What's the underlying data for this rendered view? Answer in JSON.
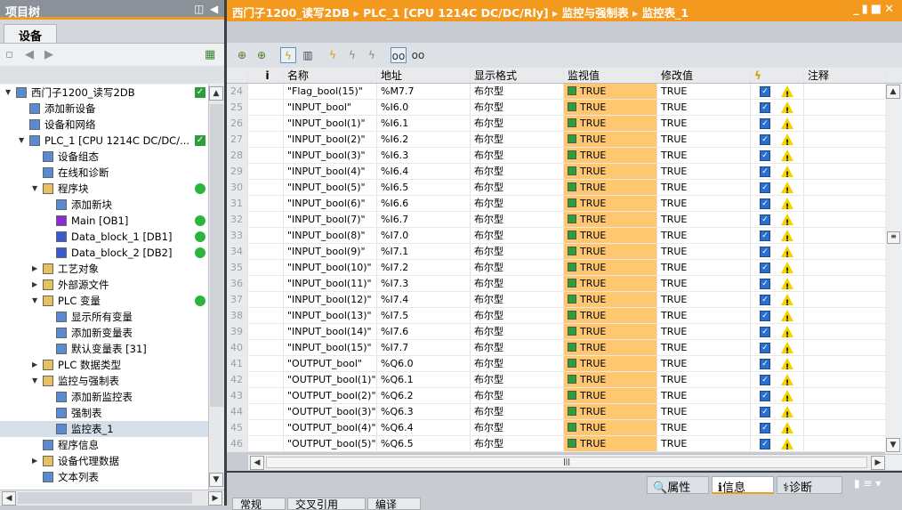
{
  "project_tree": {
    "title": "项目树",
    "tab": "设备",
    "items": [
      {
        "label": "西门子1200_读写2DB",
        "indent": 0,
        "expanded": true,
        "icon": "project-icon",
        "status": "check"
      },
      {
        "label": "添加新设备",
        "indent": 1,
        "icon": "add-device-icon"
      },
      {
        "label": "设备和网络",
        "indent": 1,
        "icon": "network-icon"
      },
      {
        "label": "PLC_1 [CPU 1214C DC/DC/...",
        "indent": 1,
        "expanded": true,
        "icon": "plc-icon",
        "status": "check"
      },
      {
        "label": "设备组态",
        "indent": 2,
        "icon": "device-config-icon"
      },
      {
        "label": "在线和诊断",
        "indent": 2,
        "icon": "diagnostics-icon"
      },
      {
        "label": "程序块",
        "indent": 2,
        "expanded": true,
        "icon": "folder-icon",
        "status": "ok"
      },
      {
        "label": "添加新块",
        "indent": 3,
        "icon": "add-block-icon"
      },
      {
        "label": "Main [OB1]",
        "indent": 3,
        "icon": "ob-icon",
        "status": "ok"
      },
      {
        "label": "Data_block_1 [DB1]",
        "indent": 3,
        "icon": "db-icon",
        "status": "ok"
      },
      {
        "label": "Data_block_2 [DB2]",
        "indent": 3,
        "icon": "db-icon",
        "status": "ok"
      },
      {
        "label": "工艺对象",
        "indent": 2,
        "expanded": false,
        "icon": "folder-icon"
      },
      {
        "label": "外部源文件",
        "indent": 2,
        "expanded": false,
        "icon": "folder-icon"
      },
      {
        "label": "PLC 变量",
        "indent": 2,
        "expanded": true,
        "icon": "folder-icon",
        "status": "ok"
      },
      {
        "label": "显示所有变量",
        "indent": 3,
        "icon": "tags-icon"
      },
      {
        "label": "添加新变量表",
        "indent": 3,
        "icon": "add-tag-table-icon"
      },
      {
        "label": "默认变量表 [31]",
        "indent": 3,
        "icon": "tag-table-icon"
      },
      {
        "label": "PLC 数据类型",
        "indent": 2,
        "expanded": false,
        "icon": "folder-icon"
      },
      {
        "label": "监控与强制表",
        "indent": 2,
        "expanded": true,
        "icon": "folder-icon"
      },
      {
        "label": "添加新监控表",
        "indent": 3,
        "icon": "add-watch-table-icon"
      },
      {
        "label": "强制表",
        "indent": 3,
        "icon": "force-table-icon"
      },
      {
        "label": "监控表_1",
        "indent": 3,
        "icon": "watch-table-icon",
        "selected": true
      },
      {
        "label": "程序信息",
        "indent": 2,
        "icon": "program-info-icon"
      },
      {
        "label": "设备代理数据",
        "indent": 2,
        "expanded": false,
        "icon": "folder-icon"
      },
      {
        "label": "文本列表",
        "indent": 2,
        "icon": "text-list-icon"
      }
    ]
  },
  "editor": {
    "breadcrumb": [
      "西门子1200_读写2DB",
      "PLC_1 [CPU 1214C DC/DC/Rly]",
      "监控与强制表",
      "监控表_1"
    ],
    "columns": [
      "",
      "i",
      "名称",
      "地址",
      "显示格式",
      "监视值",
      "修改值",
      "",
      "注释"
    ],
    "rows": [
      [
        "24",
        "\"Flag_bool(15)\"",
        "%M7.7"
      ],
      [
        "25",
        "\"INPUT_bool\"",
        "%I6.0"
      ],
      [
        "26",
        "\"INPUT_bool(1)\"",
        "%I6.1"
      ],
      [
        "27",
        "\"INPUT_bool(2)\"",
        "%I6.2"
      ],
      [
        "28",
        "\"INPUT_bool(3)\"",
        "%I6.3"
      ],
      [
        "29",
        "\"INPUT_bool(4)\"",
        "%I6.4"
      ],
      [
        "30",
        "\"INPUT_bool(5)\"",
        "%I6.5"
      ],
      [
        "31",
        "\"INPUT_bool(6)\"",
        "%I6.6"
      ],
      [
        "32",
        "\"INPUT_bool(7)\"",
        "%I6.7"
      ],
      [
        "33",
        "\"INPUT_bool(8)\"",
        "%I7.0"
      ],
      [
        "34",
        "\"INPUT_bool(9)\"",
        "%I7.1"
      ],
      [
        "35",
        "\"INPUT_bool(10)\"",
        "%I7.2"
      ],
      [
        "36",
        "\"INPUT_bool(11)\"",
        "%I7.3"
      ],
      [
        "37",
        "\"INPUT_bool(12)\"",
        "%I7.4"
      ],
      [
        "38",
        "\"INPUT_bool(13)\"",
        "%I7.5"
      ],
      [
        "39",
        "\"INPUT_bool(14)\"",
        "%I7.6"
      ],
      [
        "40",
        "\"INPUT_bool(15)\"",
        "%I7.7"
      ],
      [
        "41",
        "\"OUTPUT_bool\"",
        "%Q6.0"
      ],
      [
        "42",
        "\"OUTPUT_bool(1)\"",
        "%Q6.1"
      ],
      [
        "43",
        "\"OUTPUT_bool(2)\"",
        "%Q6.2"
      ],
      [
        "44",
        "\"OUTPUT_bool(3)\"",
        "%Q6.3"
      ],
      [
        "45",
        "\"OUTPUT_bool(4)\"",
        "%Q6.4"
      ],
      [
        "46",
        "\"OUTPUT_bool(5)\"",
        "%Q6.5"
      ]
    ],
    "format": "布尔型",
    "monitor_value": "TRUE",
    "modify_value": "TRUE"
  },
  "inspector": {
    "tabs": [
      "属性",
      "信息",
      "诊断"
    ],
    "active": "信息",
    "subtabs": [
      "常规",
      "交叉引用",
      "编译"
    ]
  },
  "colors": {
    "accent": "#f39a1e",
    "monitor_bg": "#ffc870",
    "ok_green": "#2c9e3c"
  }
}
